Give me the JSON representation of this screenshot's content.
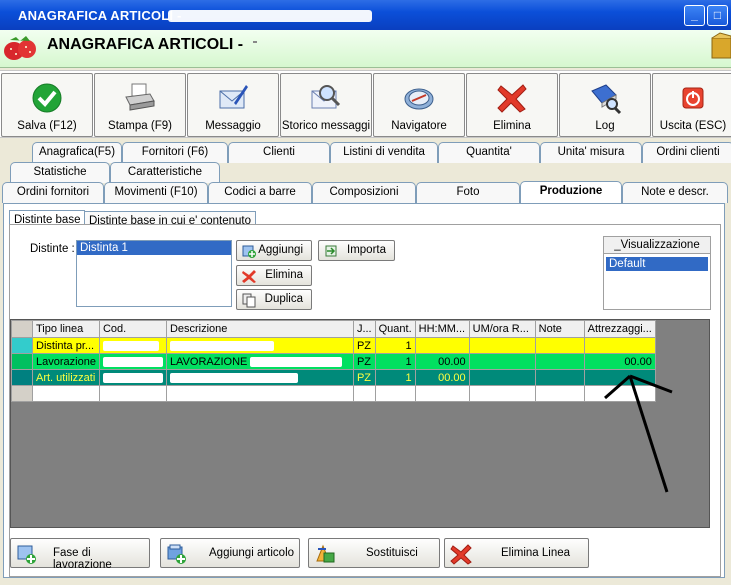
{
  "window": {
    "title": "ANAGRAFICA ARTICOLI -",
    "minimize": "_",
    "maximize": "□"
  },
  "header": {
    "title": "ANAGRAFICA ARTICOLI -"
  },
  "toolbar": {
    "items": [
      {
        "label": "Salva (F12)",
        "icon": "check-icon"
      },
      {
        "label": "Stampa (F9)",
        "icon": "printer-icon"
      },
      {
        "label": "Messaggio",
        "icon": "envelope-pen-icon"
      },
      {
        "label": "Storico messaggi",
        "icon": "envelope-search-icon"
      },
      {
        "label": "Navigatore",
        "icon": "compass-icon"
      },
      {
        "label": "Elimina",
        "icon": "red-x-icon"
      },
      {
        "label": "Log",
        "icon": "book-magnifier-icon"
      },
      {
        "label": "Uscita (ESC)",
        "icon": "power-icon"
      }
    ]
  },
  "tabs": {
    "row1": [
      "Anagrafica(F5)",
      "Fornitori (F6)",
      "Clienti",
      "Listini di vendita",
      "Quantita'",
      "Unita' misura",
      "Ordini clienti"
    ],
    "row2": [
      "Statistiche",
      "Caratteristiche"
    ],
    "row3": [
      "Ordini fornitori",
      "Movimenti (F10)",
      "Codici a barre",
      "Composizioni",
      "Foto",
      "Produzione",
      "Note e descr."
    ],
    "active": "Produzione"
  },
  "subtabs": [
    "Distinte base",
    "Distinte base in cui e' contenuto"
  ],
  "distinte": {
    "label": "Distinte :",
    "items": [
      "Distinta 1"
    ],
    "buttons": {
      "aggiungi": "Aggiungi",
      "elimina": "Elimina",
      "duplica": "Duplica",
      "importa": "Importa"
    }
  },
  "visualizzazione": {
    "title": "_Visualizzazione",
    "items": [
      "Default"
    ]
  },
  "grid": {
    "columns": [
      "Tipo linea",
      "Cod.",
      "Descrizione",
      "J...",
      "Quant.",
      "HH:MM...",
      "UM/ora R...",
      "Note",
      "Attrezzaggi..."
    ],
    "rows": [
      {
        "tipo": "Distinta pr...",
        "desc": "",
        "um": "PZ",
        "quant": "1",
        "hh": "",
        "attr": ""
      },
      {
        "tipo": "Lavorazione",
        "desc": "LAVORAZIONE",
        "um": "PZ",
        "quant": "1",
        "hh": "00.00",
        "attr": "00.00"
      },
      {
        "tipo": "Art. utilizzati",
        "desc": "",
        "um": "PZ",
        "quant": "1",
        "hh": "00.00",
        "attr": ""
      }
    ]
  },
  "bottom_buttons": [
    "Fase di lavorazione",
    "Aggiungi articolo",
    "Sostituisci",
    "Elimina Linea"
  ],
  "colors": {
    "title_bar": "#0b4fd9",
    "header_bg": "#d6f7cf",
    "row_distinta": "#ffff00",
    "row_lavorazione": "#00e060",
    "row_articoli": "#008a7a",
    "selection": "#316ac5"
  }
}
